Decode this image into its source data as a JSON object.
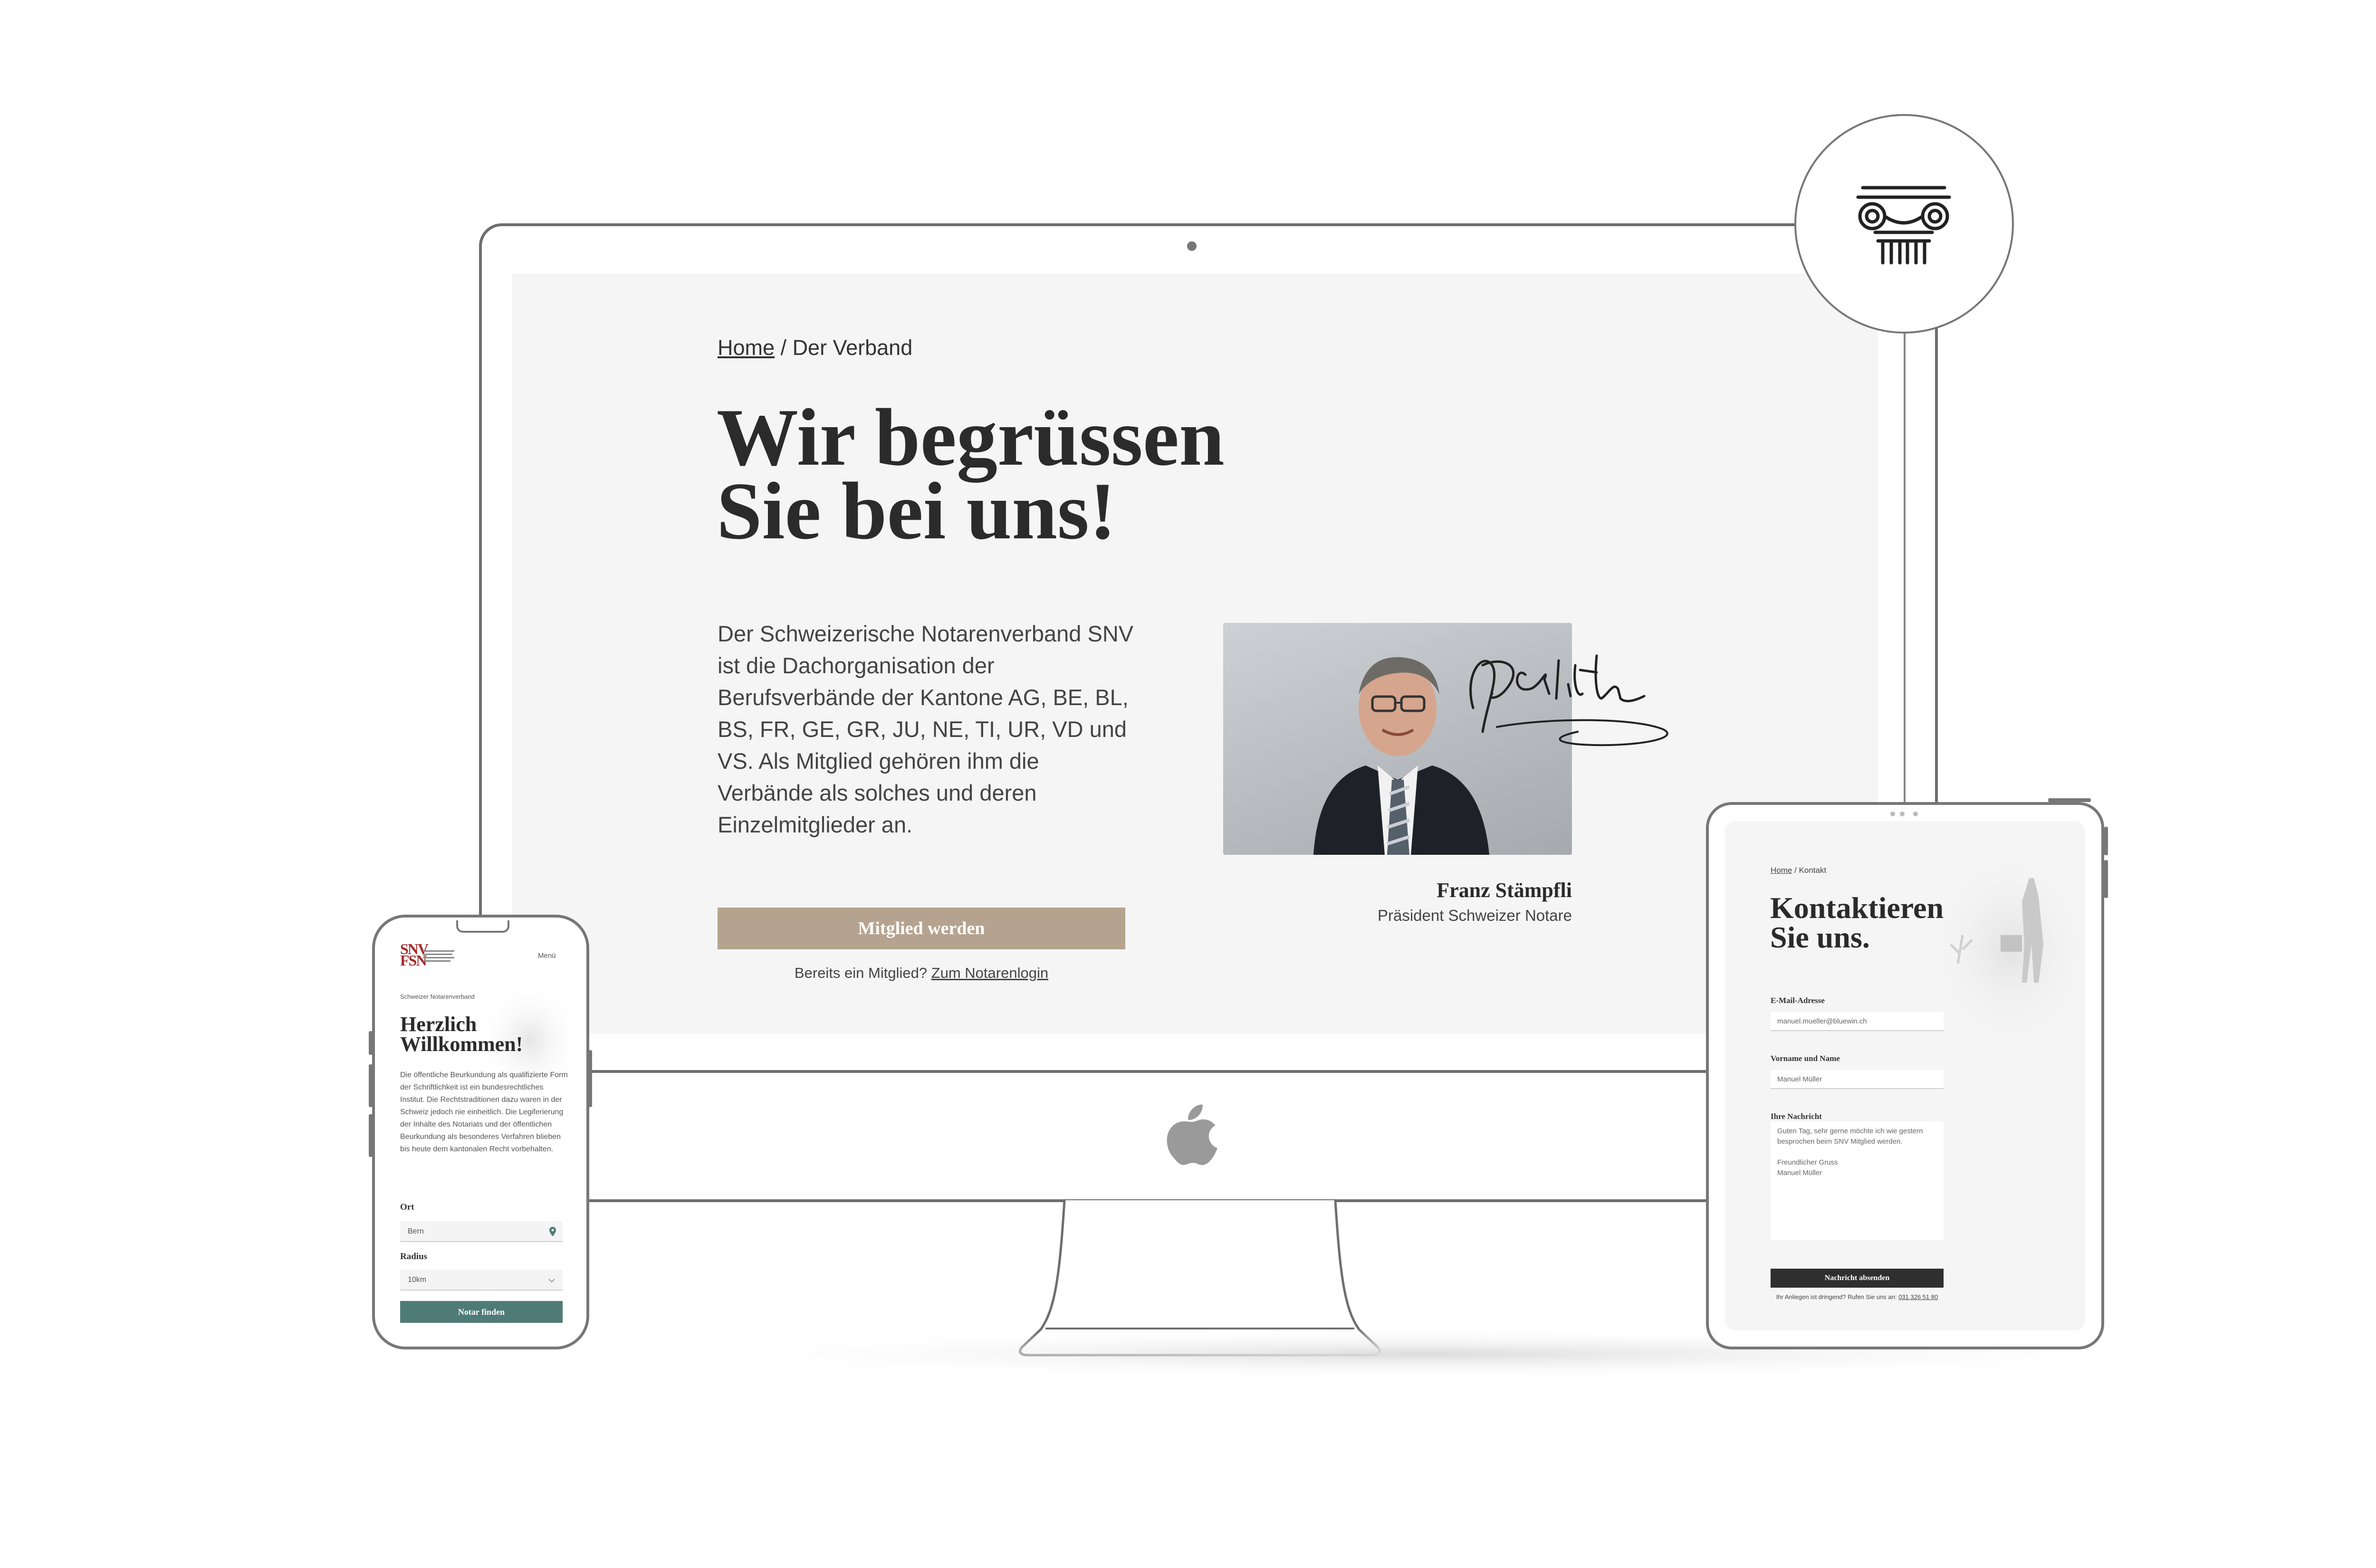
{
  "desktop": {
    "breadcrumb": {
      "home": "Home",
      "separator": " / ",
      "current": "Der Verband"
    },
    "hero_title_line1": "Wir begrüssen",
    "hero_title_line2": "Sie bei uns!",
    "intro": "Der Schweizerische Notarenverband SNV ist die Dachorganisation der Berufsverbände der Kantone AG, BE, BL, BS, FR, GE, GR, JU, NE, TI, UR, VD und VS. Als Mitglied gehören ihm die Verbände als solches und deren Einzelmitglieder an.",
    "president_name": "Franz Stämpfli",
    "president_role": "Präsident Schweizer Notare",
    "cta_label": "Mitglied werden",
    "login_prefix": "Bereits ein Mitglied? ",
    "login_link": "Zum Notarenlogin"
  },
  "phone": {
    "logo_line1": "SNV",
    "logo_line2": "FSN",
    "menu_label": "Menü",
    "overline": "Schweizer Notarenverband",
    "title_line1": "Herzlich",
    "title_line2": "Willkommen!",
    "body": "Die öffentliche Beurkundung als qualifizierte Form der Schriftlichkeit ist ein bundesrechtliches Institut. Die Rechtstraditionen dazu waren in der Schweiz jedoch nie einheitlich. Die Legiferierung der Inhalte des Notariats und der öffentlichen Beurkundung als besonderes Verfahren blieben bis heute dem kantonalen Recht vorbehalten.",
    "location_label": "Ort",
    "location_value": "Bern",
    "radius_label": "Radius",
    "radius_value": "10km",
    "button_label": "Notar finden"
  },
  "tablet": {
    "breadcrumb": {
      "home": "Home",
      "separator": " / ",
      "current": "Kontakt"
    },
    "title_line1": "Kontaktieren",
    "title_line2": "Sie uns.",
    "email_label": "E-Mail-Adresse",
    "email_value": "manuel.mueller@bluewin.ch",
    "name_label": "Vorname und Name",
    "name_value": "Manuel Müller",
    "message_label": "Ihre Nachricht",
    "message_value": "Guten Tag, sehr gerne möchte ich wie gestern besprochen beim SNV Mitglied werden.\n\nFreundlicher Gruss\nManuel Müller",
    "button_label": "Nachricht absenden",
    "footer_prefix": "Ihr Anliegen ist dringend? Rufen Sie uns an: ",
    "footer_phone": "031 326 51 80"
  },
  "colors": {
    "cta": "#b5a38f",
    "phone_button": "#4f7b76",
    "tablet_button": "#2f2f2f",
    "screen_bg": "#f5f5f5",
    "device_stroke": "#6e6e6e"
  },
  "icons": [
    "ionic-column-icon",
    "apple-logo-icon",
    "map-pin-icon",
    "chevron-down-icon"
  ]
}
